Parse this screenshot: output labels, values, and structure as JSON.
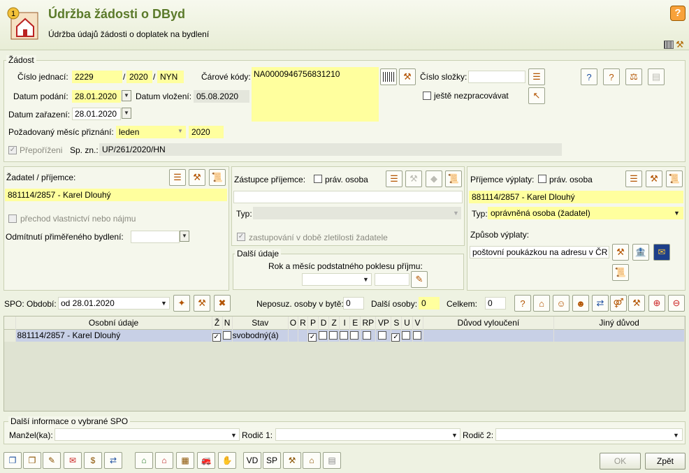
{
  "header": {
    "title": "Údržba žádosti o DByd",
    "subtitle": "Údržba údajů žádosti o doplatek na bydlení",
    "help_icon": "help-icon",
    "app_icon": "house-icon"
  },
  "zadost": {
    "legend": "Žádost",
    "cislo_jednaci_label": "Číslo jednací:",
    "cj_number": "2229",
    "cj_year_sep": "/",
    "cj_year": "2020",
    "cj_suffix_sep": "/",
    "cj_suffix": "NYN",
    "datum_podani_label": "Datum podání:",
    "datum_podani": "28.01.2020",
    "datum_vlozeni_label": "Datum vložení:",
    "datum_vlozeni": "05.08.2020",
    "datum_zarazeni_label": "Datum zařazení:",
    "datum_zarazeni": "28.01.2020",
    "pozadovany_mesic_label": "Požadovaný měsíc přiznání:",
    "mesic": "leden",
    "rok": "2020",
    "prepofizeni_label": "Přepoříženi",
    "sp_zn_label": "Sp. zn.:",
    "sp_zn": "UP/261/2020/HN",
    "carove_kody_label": "Čárové kódy:",
    "carovy_kod": "NA0000946756831210",
    "cislo_slozky_label": "Číslo složky:",
    "cislo_slozky": "",
    "jeste_nezpracovavat_label": "ještě nezpracovávat"
  },
  "zadatel": {
    "label": "Žadatel / příjemce:",
    "value": "881114/2857 - Karel Dlouhý",
    "prechod_label": "přechod vlastnictví nebo nájmu",
    "odmitnuti_label": "Odmítnutí přiměřeného bydlení:",
    "odmitnuti_value": ""
  },
  "zastupce": {
    "label": "Zástupce příjemce:",
    "prav_osoba_label": "práv. osoba",
    "value": "",
    "typ_label": "Typ:",
    "typ_value": "",
    "zastupovani_label": "zastupování v době zletilosti žadatele"
  },
  "dalsi_udaje": {
    "legend": "Další údaje",
    "rok_mesic_label": "Rok a měsíc podstatného poklesu příjmu:",
    "month": "",
    "year": ""
  },
  "prijemce": {
    "label": "Příjemce výplaty:",
    "prav_osoba_label": "práv. osoba",
    "value": "881114/2857 - Karel Dlouhý",
    "typ_label": "Typ:",
    "typ_value": "oprávněná osoba (žadatel)",
    "zpusob_label": "Způsob výplaty:",
    "zpusob_value": "poštovní poukázkou na adresu v ČR"
  },
  "spo": {
    "obdobi_label": "SPO: Období:",
    "obdobi_value": "od 28.01.2020",
    "neposuz_label": "Neposuz. osoby v bytě:",
    "neposuz_value": "0",
    "dalsi_osoby_label": "Další osoby:",
    "dalsi_osoby_value": "0",
    "celkem_label": "Celkem:",
    "celkem_value": "0"
  },
  "table": {
    "columns": [
      "Osobní údaje",
      "Ž",
      "N",
      "Stav",
      "O",
      "R",
      "P",
      "D",
      "Z",
      "I",
      "E",
      "RP",
      "VP",
      "S",
      "U",
      "V",
      "Důvod vyloučení",
      "Jiný důvod"
    ],
    "rows": [
      {
        "osoba": "881114/2857 - Karel Dlouhý",
        "stav": "svobodný(á)"
      }
    ]
  },
  "dalsi_info": {
    "legend": "Další informace o vybrané SPO",
    "manzel_label": "Manžel(ka):",
    "rodic1_label": "Rodič 1:",
    "rodic2_label": "Rodič 2:"
  },
  "footer": {
    "vd_label": "VD",
    "sp_label": "SP",
    "ok_label": "OK",
    "zpet_label": "Zpět"
  }
}
